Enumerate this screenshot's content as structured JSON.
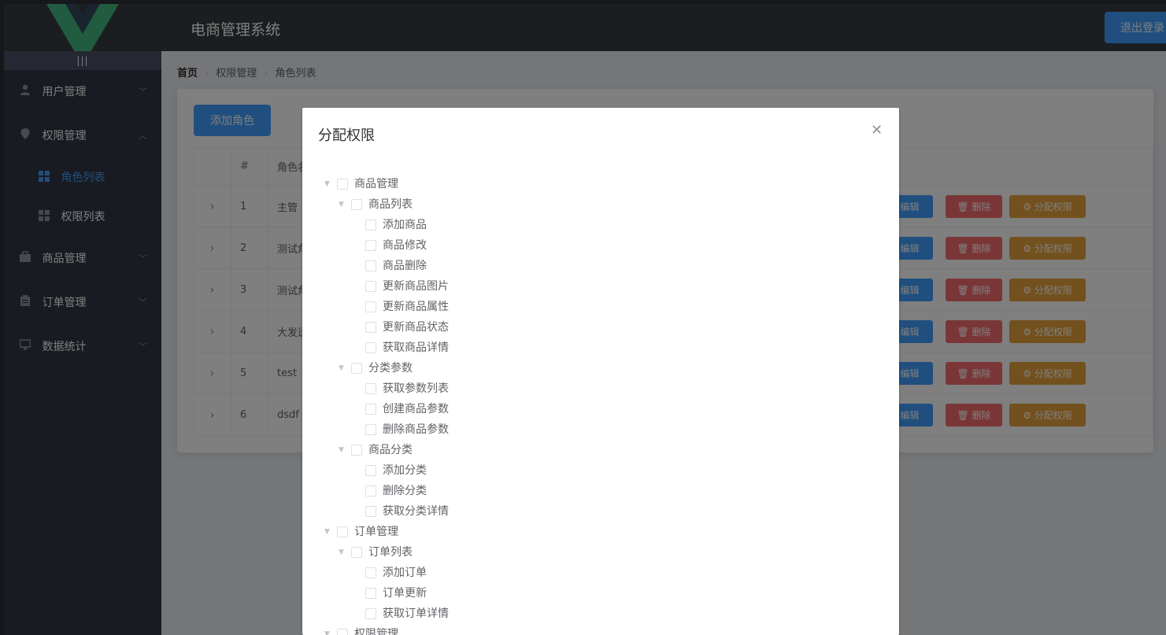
{
  "header": {
    "title": "电商管理系统",
    "logout_label": "退出登录",
    "colors": {
      "header_bg": "#373d41",
      "logo_green": "#42b983",
      "logo_dark": "#35495e"
    }
  },
  "sidebar": {
    "toggle_label": "|||",
    "menus": [
      {
        "label": "用户管理",
        "icon": "user-icon",
        "expanded": false
      },
      {
        "label": "权限管理",
        "icon": "location-icon",
        "expanded": true,
        "children": [
          {
            "label": "角色列表",
            "icon": "grid-icon",
            "active": true
          },
          {
            "label": "权限列表",
            "icon": "grid-icon",
            "active": false
          }
        ]
      },
      {
        "label": "商品管理",
        "icon": "shopping-bag-icon",
        "expanded": false
      },
      {
        "label": "订单管理",
        "icon": "clipboard-icon",
        "expanded": false
      },
      {
        "label": "数据统计",
        "icon": "monitor-icon",
        "expanded": false
      }
    ],
    "colors": {
      "active_text": "#409eff",
      "bg": "#333744"
    }
  },
  "breadcrumb": [
    "首页",
    "权限管理",
    "角色列表"
  ],
  "card": {
    "add_button_label": "添加角色",
    "table": {
      "headers": [
        "#",
        "角色名"
      ],
      "rows": [
        {
          "index": "1",
          "name": "主管"
        },
        {
          "index": "2",
          "name": "测试角"
        },
        {
          "index": "3",
          "name": "测试角"
        },
        {
          "index": "4",
          "name": "大发送"
        },
        {
          "index": "5",
          "name": "test"
        },
        {
          "index": "6",
          "name": "dsdf"
        }
      ],
      "actions": {
        "edit": "编辑",
        "delete": "删除",
        "assign": "分配权限"
      }
    }
  },
  "dialog": {
    "title": "分配权限",
    "tree": [
      {
        "level": 0,
        "label": "商品管理",
        "expanded": true
      },
      {
        "level": 1,
        "label": "商品列表",
        "expanded": true
      },
      {
        "level": 2,
        "label": "添加商品"
      },
      {
        "level": 2,
        "label": "商品修改"
      },
      {
        "level": 2,
        "label": "商品删除"
      },
      {
        "level": 2,
        "label": "更新商品图片"
      },
      {
        "level": 2,
        "label": "更新商品属性"
      },
      {
        "level": 2,
        "label": "更新商品状态"
      },
      {
        "level": 2,
        "label": "获取商品详情"
      },
      {
        "level": 1,
        "label": "分类参数",
        "expanded": true
      },
      {
        "level": 2,
        "label": "获取参数列表"
      },
      {
        "level": 2,
        "label": "创建商品参数"
      },
      {
        "level": 2,
        "label": "删除商品参数"
      },
      {
        "level": 1,
        "label": "商品分类",
        "expanded": true
      },
      {
        "level": 2,
        "label": "添加分类"
      },
      {
        "level": 2,
        "label": "删除分类"
      },
      {
        "level": 2,
        "label": "获取分类详情"
      },
      {
        "level": 0,
        "label": "订单管理",
        "expanded": true
      },
      {
        "level": 1,
        "label": "订单列表",
        "expanded": true
      },
      {
        "level": 2,
        "label": "添加订单"
      },
      {
        "level": 2,
        "label": "订单更新"
      },
      {
        "level": 2,
        "label": "获取订单详情"
      },
      {
        "level": 0,
        "label": "权限管理",
        "expanded": true
      }
    ]
  }
}
